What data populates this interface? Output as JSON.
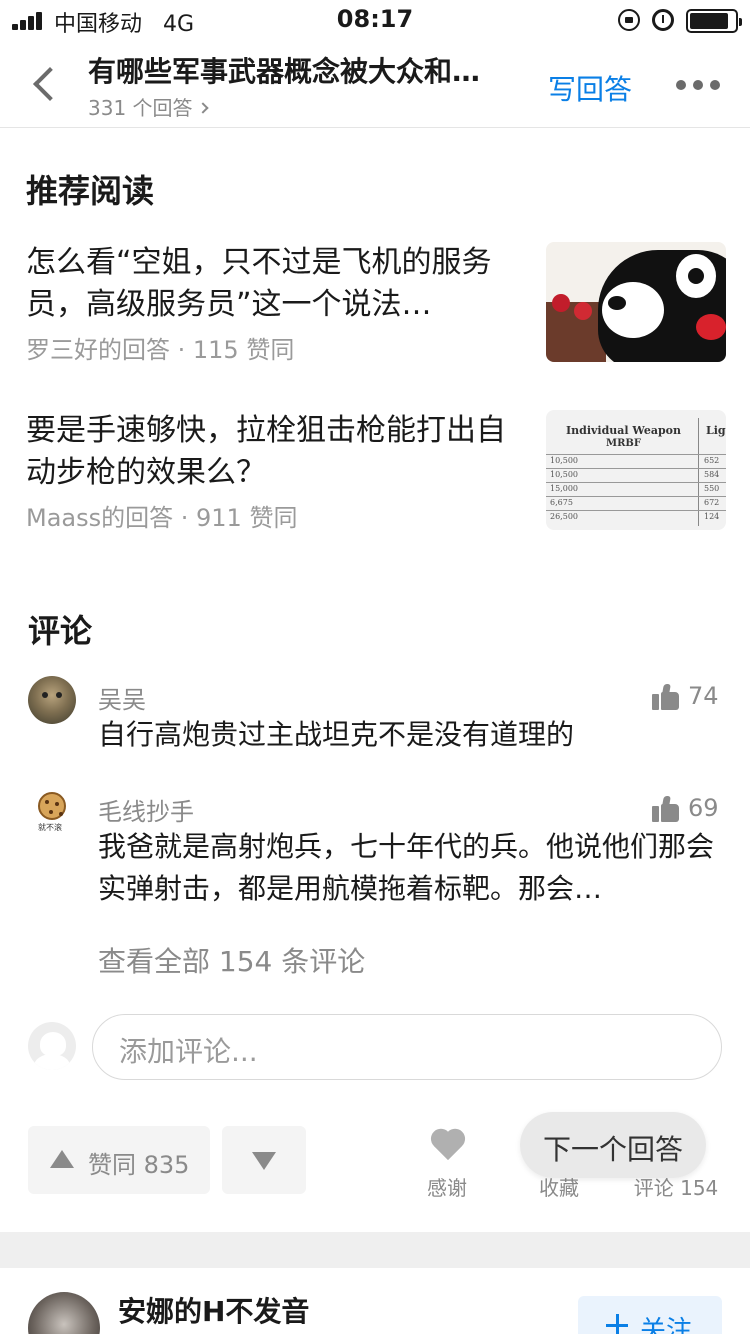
{
  "status_bar": {
    "carrier": "中国移动",
    "network": "4G",
    "time": "08:17"
  },
  "nav": {
    "title": "有哪些军事武器概念被大众和…",
    "answer_count": "331 个回答",
    "write_answer": "写回答"
  },
  "recommended": {
    "heading": "推荐阅读",
    "items": [
      {
        "title": "怎么看“空姐，只不过是飞机的服务员，高级服务员”这一个说法…",
        "meta": "罗三好的回答 · 115 赞同",
        "thumb": "kumamon-photo"
      },
      {
        "title": "要是手速够快，拉栓狙击枪能打出自动步枪的效果么？",
        "meta": "Maass的回答 · 911 赞同",
        "thumb": "weapons-table-image"
      }
    ]
  },
  "comments": {
    "heading": "评论",
    "items": [
      {
        "author": "吴吴",
        "likes": "74",
        "text": "自行高炮贵过主战坦克不是没有道理的"
      },
      {
        "author": "毛线抄手",
        "likes": "69",
        "text": "我爸就是高射炮兵，七十年代的兵。他说他们那会实弹射击，都是用航模拖着标靶。那会…"
      }
    ],
    "view_all": "查看全部 154 条评论",
    "input_placeholder": "添加评论..."
  },
  "actions": {
    "upvote": "赞同 835",
    "thanks": "感谢",
    "collect": "收藏",
    "comment": "评论 154",
    "next_answer": "下一个回答"
  },
  "next_author": {
    "name": "安娜的H不发音",
    "follow": "关注"
  },
  "colors": {
    "accent": "#0a7fe6",
    "text_primary": "#1a1a1a",
    "text_secondary": "#8a8a8a"
  }
}
